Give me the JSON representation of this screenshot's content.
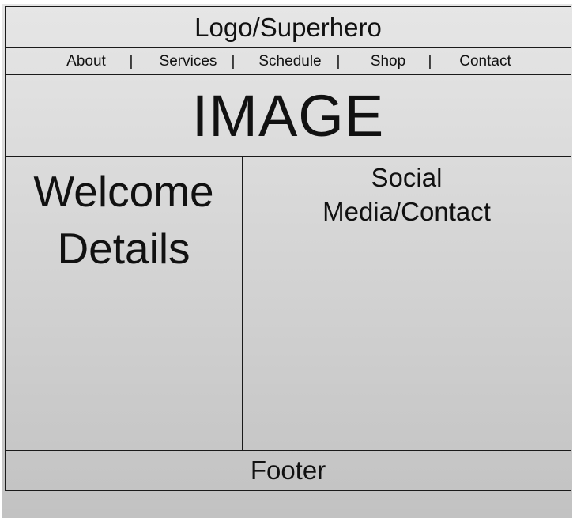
{
  "header": {
    "title": "Logo/Superhero"
  },
  "nav": {
    "items": [
      "About",
      "Services",
      "Schedule",
      "Shop",
      "Contact"
    ],
    "separator": "|"
  },
  "hero": {
    "label": "IMAGE"
  },
  "welcome": {
    "line1": "Welcome",
    "line2": "Details"
  },
  "social": {
    "line1": "Social",
    "line2": "Media/Contact"
  },
  "footer": {
    "label": "Footer"
  }
}
